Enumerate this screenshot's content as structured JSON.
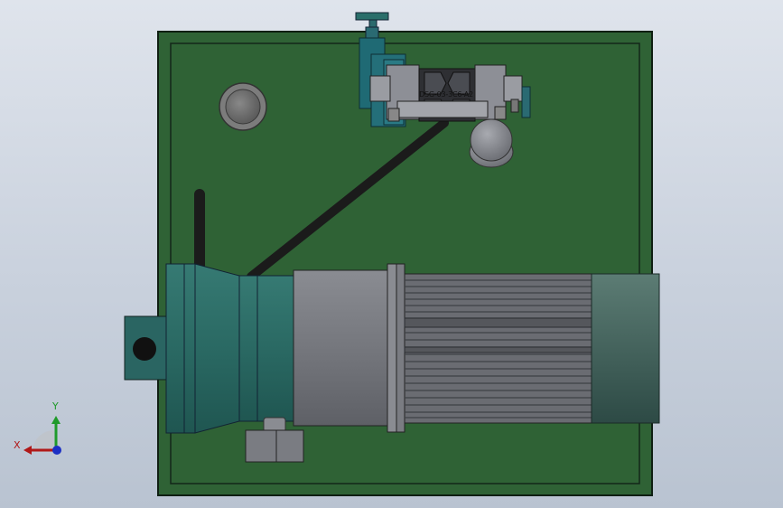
{
  "model": {
    "valve_part_number": "DSG-03-3C6-A2"
  },
  "triad": {
    "x_label": "X",
    "y_label": "Y",
    "x_color": "#b01818",
    "y_color": "#1f9a2a",
    "z_color": "#1b2fc4"
  },
  "colors": {
    "tank_plate": "#2f6235",
    "tank_border": "#0f1f12",
    "pump_teal": "#2b6c66",
    "motor_gray": "#7d7f85",
    "motor_fins": "#5a5c62",
    "hose": "#1b1b1b",
    "valve_body": "#8d8f96",
    "cap_teal": "#1f6a74"
  },
  "icons": {
    "tank_plate": "tank-top-plate",
    "breather": "filler-breather-cap",
    "valve": "directional-valve",
    "motor": "electric-motor",
    "pump": "hydraulic-pump",
    "hose": "hydraulic-hose",
    "triad": "coordinate-triad-icon"
  }
}
